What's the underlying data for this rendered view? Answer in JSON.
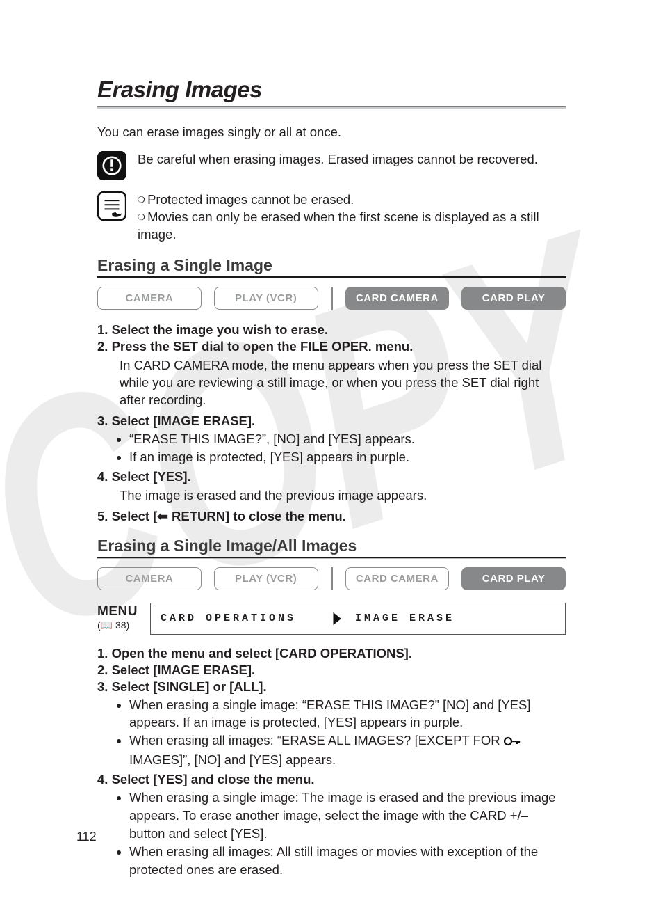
{
  "page": {
    "title": "Erasing Images",
    "intro": "You can erase images singly or all at once.",
    "warning": "Be careful when erasing images. Erased images cannot be recovered.",
    "notes": [
      "Protected images cannot be erased.",
      "Movies can only be erased when the first scene is displayed as a still image."
    ],
    "page_number": "112"
  },
  "chart_data": {
    "type": "table",
    "title": "Mode availability",
    "columns": [
      "CAMERA",
      "PLAY (VCR)",
      "CARD CAMERA",
      "CARD PLAY"
    ],
    "rows": [
      {
        "section": "Erasing a Single Image",
        "available": [
          false,
          false,
          true,
          true
        ]
      },
      {
        "section": "Erasing a Single Image/All Images",
        "available": [
          false,
          false,
          false,
          true
        ]
      }
    ]
  },
  "section1": {
    "heading": "Erasing a Single Image",
    "modes": [
      {
        "label": "CAMERA",
        "active": false
      },
      {
        "label": "PLAY (VCR)",
        "active": false
      },
      {
        "label": "CARD CAMERA",
        "active": true
      },
      {
        "label": "CARD PLAY",
        "active": true
      }
    ],
    "steps": {
      "s1": "1. Select the image you wish to erase.",
      "s2": "2. Press the SET dial to open the FILE OPER. menu.",
      "s2_detail": "In CARD CAMERA mode, the menu appears when you press the SET dial while you are reviewing a still image, or when you press the SET dial right after recording.",
      "s3": "3. Select [IMAGE ERASE].",
      "s3_b1": "“ERASE THIS IMAGE?”, [NO] and [YES] appears.",
      "s3_b2": "If an image is protected, [YES] appears in purple.",
      "s4": "4. Select [YES].",
      "s4_detail": "The image is erased and the previous image appears.",
      "s5_pre": "5. Select [",
      "s5_post": " RETURN] to close the menu."
    }
  },
  "section2": {
    "heading": "Erasing a Single Image/All Images",
    "modes": [
      {
        "label": "CAMERA",
        "active": false
      },
      {
        "label": "PLAY (VCR)",
        "active": false
      },
      {
        "label": "CARD CAMERA",
        "active": false
      },
      {
        "label": "CARD PLAY",
        "active": true
      }
    ],
    "menu": {
      "label": "MENU",
      "pageref": "38",
      "cell1": "CARD OPERATIONS",
      "cell2": "IMAGE ERASE"
    },
    "steps": {
      "s1": "1. Open the menu and select [CARD OPERATIONS].",
      "s2": "2. Select [IMAGE ERASE].",
      "s3": "3. Select [SINGLE] or [ALL].",
      "s3_b1": "When erasing a single image: “ERASE THIS IMAGE?” [NO] and [YES] appears. If an image is protected, [YES] appears in purple.",
      "s3_b2_pre": "When erasing all images: “ERASE ALL IMAGES? [EXCEPT FOR ",
      "s3_b2_post": " IMAGES]”, [NO] and [YES] appears.",
      "s4": "4. Select [YES] and close the menu.",
      "s4_b1": "When erasing a single image: The image is erased and the previous image appears. To erase another image, select the image with the CARD +/– button and select [YES].",
      "s4_b2": "When erasing all images: All still images or movies with exception of the protected ones are erased."
    }
  }
}
